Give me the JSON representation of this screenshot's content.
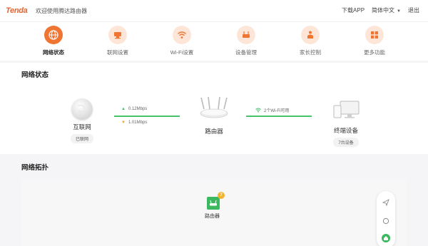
{
  "header": {
    "logo": "Tenda",
    "welcome": "欢迎使用腾达路由器",
    "download_app": "下载APP",
    "language": "简体中文",
    "logout": "退出"
  },
  "nav": {
    "items": [
      {
        "label": "网络状态",
        "icon": "globe-icon",
        "active": true
      },
      {
        "label": "联网设置",
        "icon": "network-settings-icon",
        "active": false
      },
      {
        "label": "Wi-Fi设置",
        "icon": "wifi-icon",
        "active": false
      },
      {
        "label": "设备管理",
        "icon": "device-icon",
        "active": false
      },
      {
        "label": "家长控制",
        "icon": "parent-icon",
        "active": false
      },
      {
        "label": "更多功能",
        "icon": "grid-icon",
        "active": false
      }
    ]
  },
  "network_status": {
    "title": "网络状态",
    "internet": {
      "label": "互联网",
      "status": "已联网"
    },
    "upload_speed": "0.12Mbps",
    "download_speed": "1.01Mbps",
    "router": {
      "label": "路由器"
    },
    "wifi_status": "2个Wi-Fi可用",
    "terminals": {
      "label": "终端设备",
      "count": "7台设备"
    }
  },
  "topology": {
    "title": "网络拓扑",
    "router_label": "路由器",
    "router_badge_count": "7"
  },
  "colors": {
    "accent": "#f07532",
    "accent_light": "#fde6d8",
    "link_green": "#45c26a",
    "router_green": "#3cb95e"
  }
}
